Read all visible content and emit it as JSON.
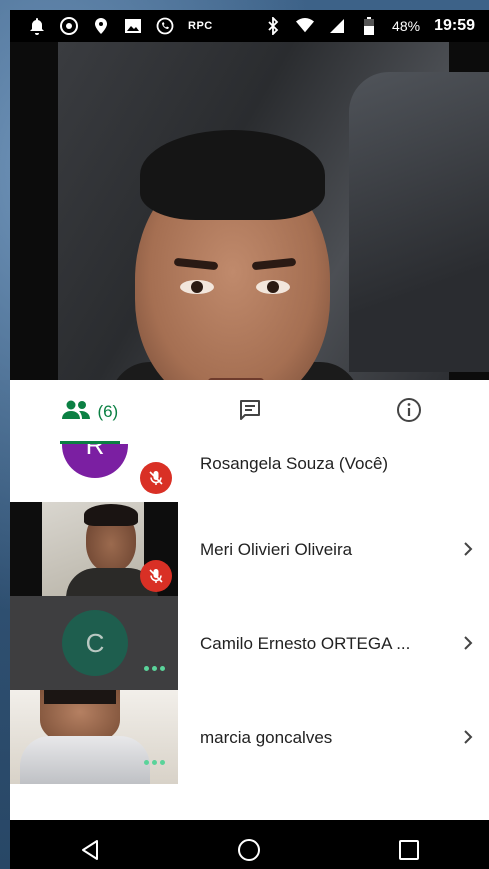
{
  "status_bar": {
    "rpc_label": "RPC",
    "battery_percent": "48%",
    "time": "19:59"
  },
  "tabs": {
    "people_count": "(6)"
  },
  "participants": [
    {
      "name": "Rosangela Souza (Você)",
      "avatar_letter": "R",
      "avatar_color": "#7b1fa2",
      "muted": true
    },
    {
      "name": "Meri Olivieri Oliveira",
      "muted": true
    },
    {
      "name": "Camilo Ernesto ORTEGA ...",
      "avatar_letter": "C",
      "avatar_color": "#1e5e4e",
      "muted": false
    },
    {
      "name": "marcia goncalves",
      "muted": false
    }
  ],
  "colors": {
    "accent": "#0b8043",
    "mute": "#d93025",
    "speaking_dots": "#5ad39a"
  }
}
